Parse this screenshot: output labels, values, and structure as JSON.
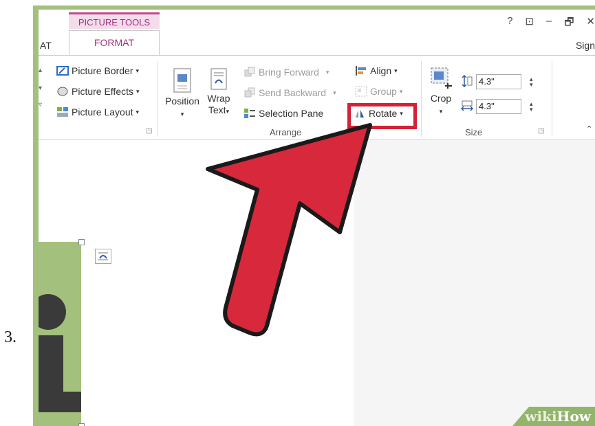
{
  "step_number": "3.",
  "tabs": {
    "context_label": "PICTURE TOOLS",
    "active_tab": "FORMAT",
    "partial_tab": "AT",
    "sign_in": "Sign",
    "window_controls": [
      "?",
      "⊡",
      "–",
      "🗗",
      "✕"
    ]
  },
  "ribbon": {
    "picture_styles": {
      "border": "Picture Border",
      "effects": "Picture Effects",
      "layout": "Picture Layout"
    },
    "arrange": {
      "position": "Position",
      "wrap_line1": "Wrap",
      "wrap_line2": "Text",
      "bring_forward": "Bring Forward",
      "send_backward": "Send Backward",
      "selection_pane": "Selection Pane",
      "align": "Align",
      "group": "Group",
      "rotate": "Rotate",
      "group_label": "Arrange"
    },
    "size": {
      "crop": "Crop",
      "height": "4.3\"",
      "width": "4.3\"",
      "group_label": "Size"
    }
  },
  "watermark": {
    "wiki": "wiki",
    "how": "How"
  },
  "colors": {
    "frame_green": "#a4c07d",
    "accent_magenta": "#a3307c",
    "highlight_red": "#d42135",
    "arrow_red": "#d7283c"
  }
}
